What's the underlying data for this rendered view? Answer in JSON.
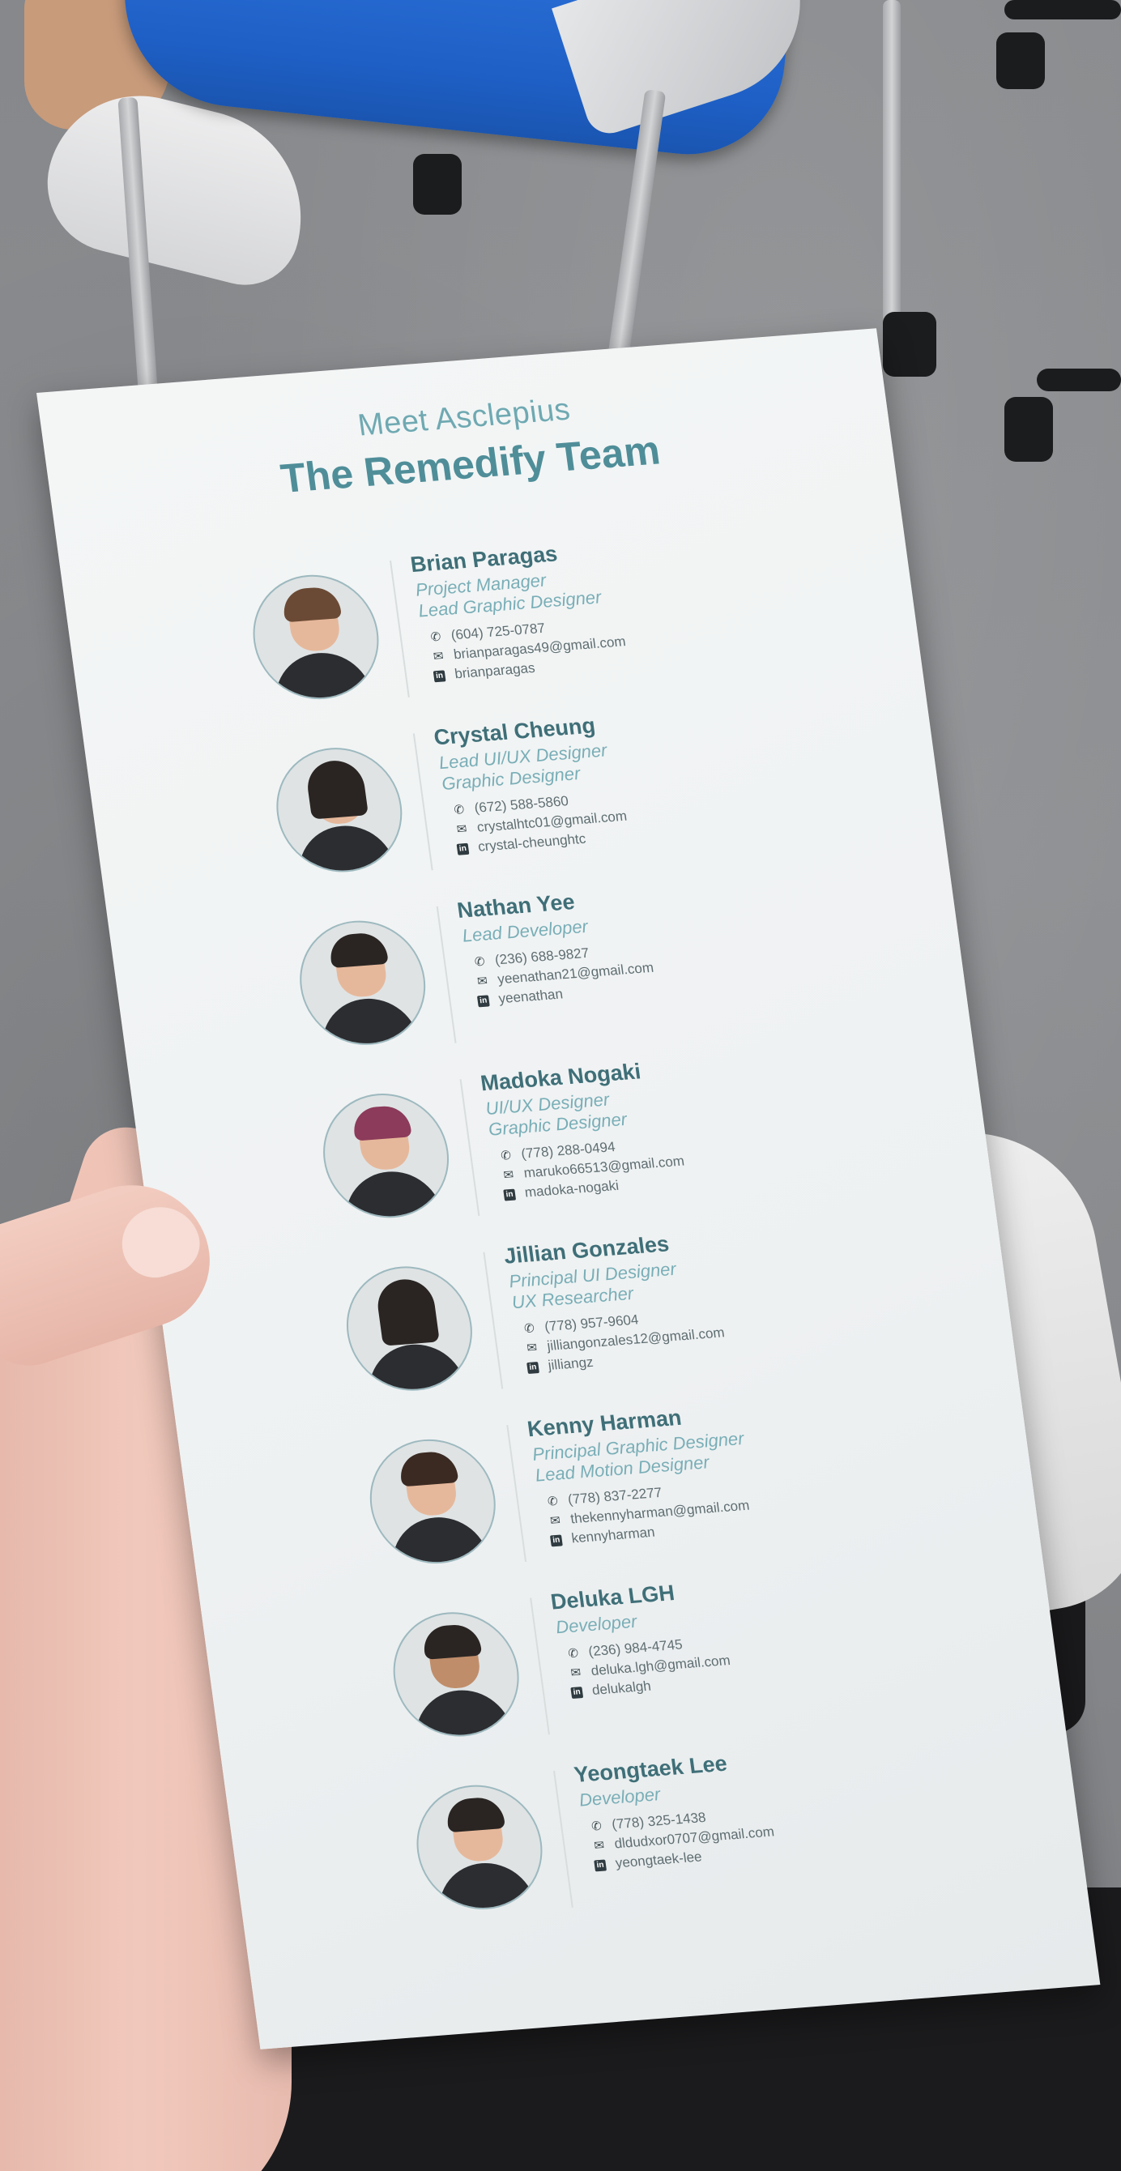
{
  "header": {
    "subtitle": "Meet Asclepius",
    "title": "The Remedify Team"
  },
  "members": [
    {
      "name": "Brian Paragas",
      "roles": [
        "Project Manager",
        "Lead Graphic Designer"
      ],
      "phone": "(604) 725-0787",
      "email": "brianparagas49@gmail.com",
      "linkedin": "brianparagas"
    },
    {
      "name": "Crystal Cheung",
      "roles": [
        "Lead UI/UX Designer",
        "Graphic Designer"
      ],
      "phone": "(672) 588-5860",
      "email": "crystalhtc01@gmail.com",
      "linkedin": "crystal-cheunghtc"
    },
    {
      "name": "Nathan Yee",
      "roles": [
        "Lead Developer"
      ],
      "phone": "(236) 688-9827",
      "email": "yeenathan21@gmail.com",
      "linkedin": "yeenathan"
    },
    {
      "name": "Madoka Nogaki",
      "roles": [
        "UI/UX Designer",
        "Graphic Designer"
      ],
      "phone": "(778) 288-0494",
      "email": "maruko66513@gmail.com",
      "linkedin": "madoka-nogaki"
    },
    {
      "name": "Jillian Gonzales",
      "roles": [
        "Principal UI Designer",
        "UX Researcher"
      ],
      "phone": "(778) 957-9604",
      "email": "jilliangonzales12@gmail.com",
      "linkedin": "jilliangz"
    },
    {
      "name": "Kenny Harman",
      "roles": [
        "Principal Graphic Designer",
        "Lead Motion Designer"
      ],
      "phone": "(778) 837-2277",
      "email": "thekennyharman@gmail.com",
      "linkedin": "kennyharman"
    },
    {
      "name": "Deluka LGH",
      "roles": [
        "Developer"
      ],
      "phone": "(236) 984-4745",
      "email": "deluka.lgh@gmail.com",
      "linkedin": "delukalgh"
    },
    {
      "name": "Yeongtaek Lee",
      "roles": [
        "Developer"
      ],
      "phone": "(778) 325-1438",
      "email": "dldudxor0707@gmail.com",
      "linkedin": "yeongtaek-lee"
    }
  ],
  "icons": {
    "phone": "phone-icon",
    "email": "email-icon",
    "linkedin": "linkedin-icon"
  },
  "colors": {
    "title": "#4f8e99",
    "subtitle": "#6fa9b2",
    "name": "#3f6f78",
    "role": "#79aeb7",
    "chair": "#1e5fc5"
  }
}
